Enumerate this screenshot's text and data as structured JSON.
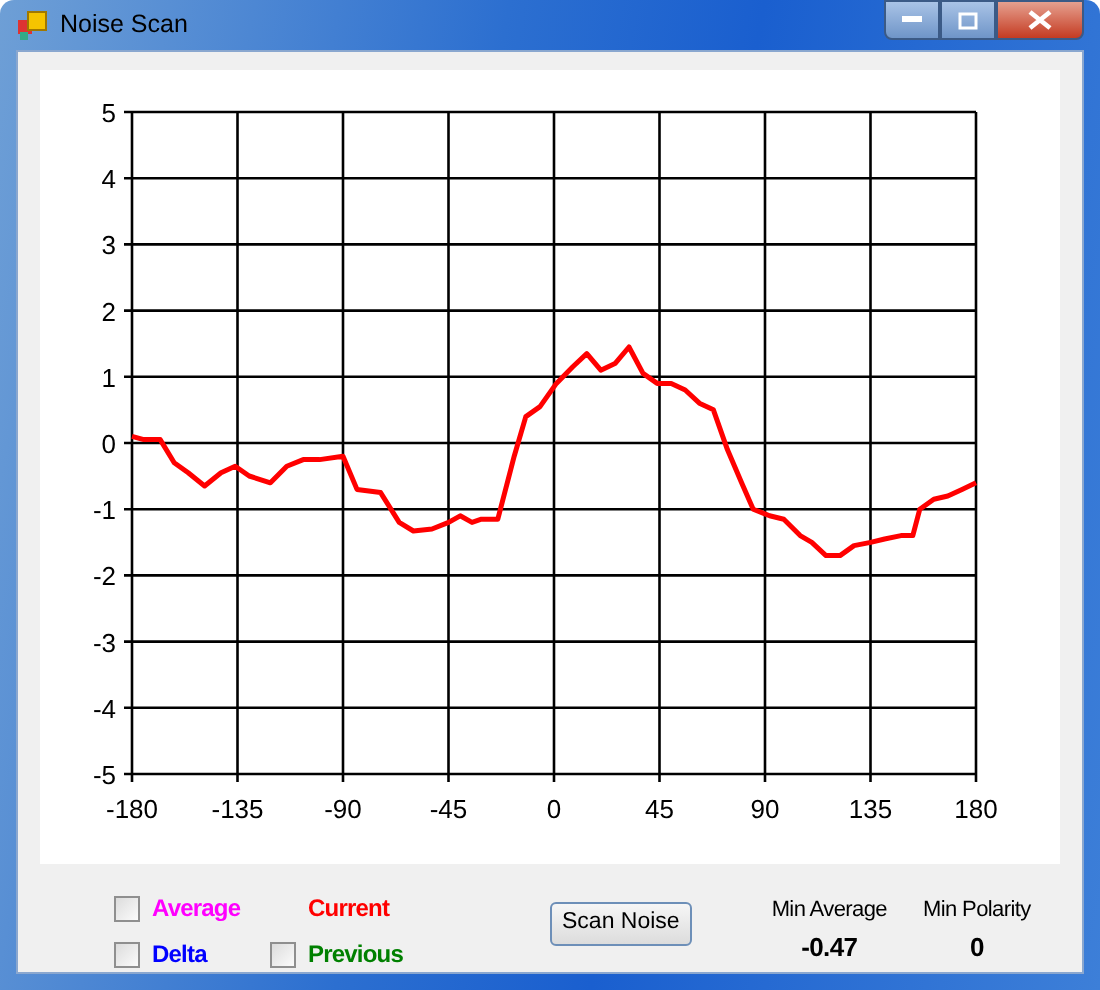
{
  "window": {
    "title": "Noise Scan"
  },
  "chart": {
    "chart_data": {
      "type": "line",
      "xlim": [
        -180,
        180
      ],
      "ylim": [
        -5,
        5
      ],
      "xticks": [
        -180,
        -135,
        -90,
        -45,
        0,
        45,
        90,
        135,
        180
      ],
      "yticks": [
        -5,
        -4,
        -3,
        -2,
        -1,
        0,
        1,
        2,
        3,
        4,
        5
      ],
      "x": [
        -180,
        -175,
        -168,
        -162,
        -156,
        -149,
        -142,
        -136,
        -130,
        -121,
        -114,
        -107,
        -100,
        -90,
        -84,
        -74,
        -66,
        -60,
        -52,
        -45,
        -40,
        -35,
        -31,
        -24,
        -17,
        -12,
        -6,
        1,
        8,
        14,
        20,
        26,
        32,
        38,
        44,
        50,
        56,
        62,
        68,
        74,
        80,
        85,
        92,
        98,
        105,
        110,
        116,
        122,
        128,
        135,
        141,
        148,
        153,
        156,
        162,
        168,
        174,
        180
      ],
      "grid": true,
      "series": [
        {
          "color": "#ff0000",
          "values": [
            0.1,
            0.05,
            0.05,
            -0.3,
            -0.45,
            -0.65,
            -0.45,
            -0.35,
            -0.5,
            -0.6,
            -0.35,
            -0.25,
            -0.25,
            -0.2,
            -0.7,
            -0.75,
            -1.2,
            -1.33,
            -1.3,
            -1.2,
            -1.1,
            -1.2,
            -1.15,
            -1.15,
            -0.2,
            0.4,
            0.55,
            0.9,
            1.15,
            1.35,
            1.1,
            1.2,
            1.45,
            1.05,
            0.9,
            0.9,
            0.8,
            0.6,
            0.5,
            -0.1,
            -0.6,
            -1.0,
            -1.1,
            -1.15,
            -1.4,
            -1.5,
            -1.7,
            -1.7,
            -1.55,
            -1.5,
            -1.45,
            -1.4,
            -1.4,
            -1.0,
            -0.85,
            -0.8,
            -0.7,
            -0.6
          ]
        }
      ]
    }
  },
  "legend": [
    {
      "kind": "checkbox",
      "label": "Average",
      "checked": false,
      "color": "#ff00ff"
    },
    {
      "kind": "label",
      "label": "Current",
      "color": "#ff0000"
    },
    {
      "kind": "checkbox",
      "label": "Delta",
      "checked": false,
      "color": "#0000ff"
    },
    {
      "kind": "checkbox",
      "label": "Previous",
      "checked": false,
      "color": "#008000"
    }
  ],
  "scan_button": {
    "label": "Scan Noise"
  },
  "readouts": [
    {
      "label": "Min Average",
      "value": "-0.47"
    },
    {
      "label": "Min Polarity",
      "value": "0"
    }
  ]
}
